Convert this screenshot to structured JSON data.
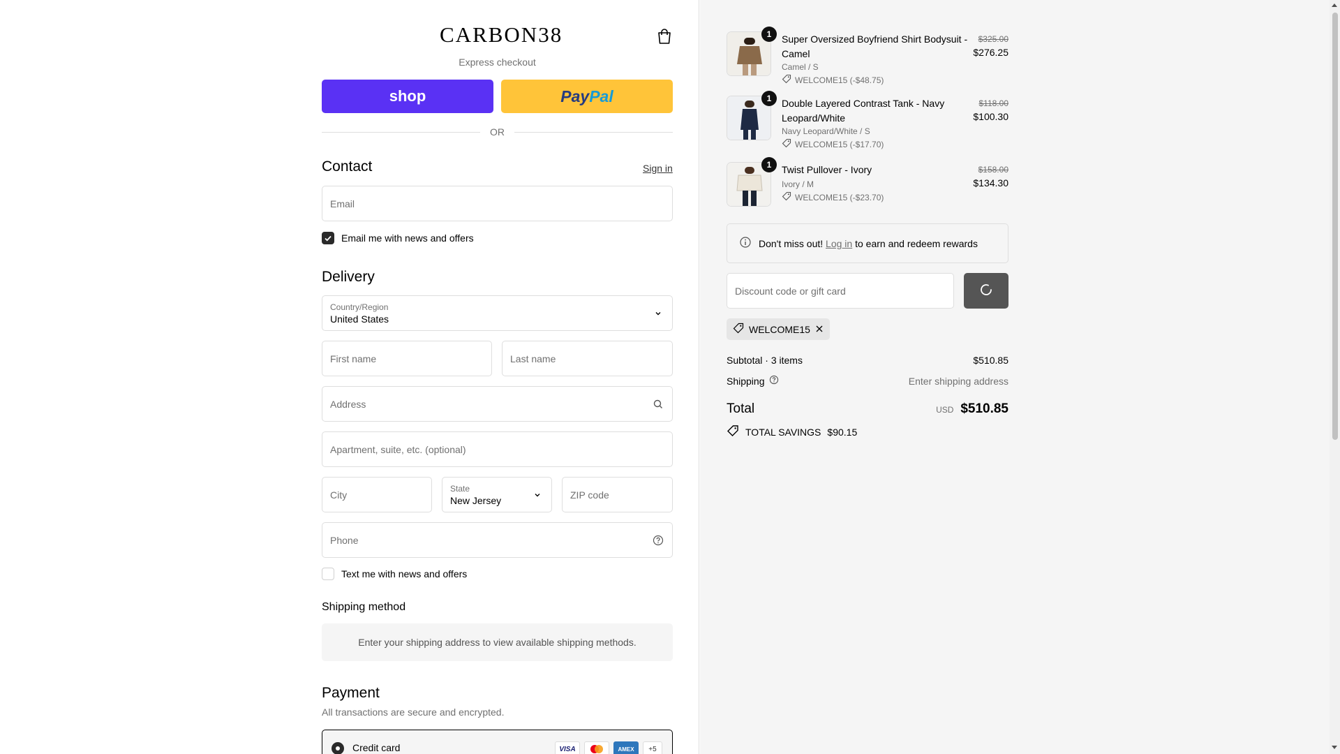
{
  "brand": {
    "logo": "CARBON38"
  },
  "express": {
    "label": "Express checkout",
    "shop_label": "shop",
    "paypal_a": "Pay",
    "paypal_b": "Pal",
    "or_label": "OR"
  },
  "contact": {
    "title": "Contact",
    "sign_in": "Sign in",
    "email_placeholder": "Email",
    "newsletter_label": "Email me with news and offers",
    "newsletter_checked": true
  },
  "delivery": {
    "title": "Delivery",
    "country_label": "Country/Region",
    "country_value": "United States",
    "first_name": "First name",
    "last_name": "Last name",
    "address": "Address",
    "apartment": "Apartment, suite, etc. (optional)",
    "city": "City",
    "state_label": "State",
    "state_value": "New Jersey",
    "zip": "ZIP code",
    "phone": "Phone",
    "sms_label": "Text me with news and offers",
    "sms_checked": false
  },
  "shipping_method": {
    "title": "Shipping method",
    "message": "Enter your shipping address to view available shipping methods."
  },
  "payment": {
    "title": "Payment",
    "subtitle": "All transactions are secure and encrypted.",
    "method_label": "Credit card",
    "brands": [
      "VISA",
      "mastercard",
      "AMEX",
      "+5"
    ]
  },
  "cart": {
    "items": [
      {
        "qty": "1",
        "name": "Super Oversized Boyfriend Shirt Bodysuit - Camel",
        "variant": "Camel / S",
        "discount": "WELCOME15 (-$48.75)",
        "original": "$325.00",
        "price": "$276.25",
        "swatch": "#8a6a4a"
      },
      {
        "qty": "1",
        "name": "Double Layered Contrast Tank - Navy Leopard/White",
        "variant": "Navy Leopard/White / S",
        "discount": "WELCOME15 (-$17.70)",
        "original": "$118.00",
        "price": "$100.30",
        "swatch": "#1e2a44"
      },
      {
        "qty": "1",
        "name": "Twist Pullover - Ivory",
        "variant": "Ivory / M",
        "discount": "WELCOME15 (-$23.70)",
        "original": "$158.00",
        "price": "$134.30",
        "swatch": "#ece6da"
      }
    ]
  },
  "rewards": {
    "text_before": "Don't miss out!",
    "link": "Log in",
    "text_after": "to earn and redeem rewards"
  },
  "discount": {
    "placeholder": "Discount code or gift card",
    "applied_code": "WELCOME15"
  },
  "summary": {
    "subtotal_label": "Subtotal · 3 items",
    "subtotal_value": "$510.85",
    "shipping_label": "Shipping",
    "shipping_value": "Enter shipping address",
    "total_label": "Total",
    "currency": "USD",
    "total_value": "$510.85",
    "savings_label": "TOTAL SAVINGS",
    "savings_value": "$90.15"
  }
}
